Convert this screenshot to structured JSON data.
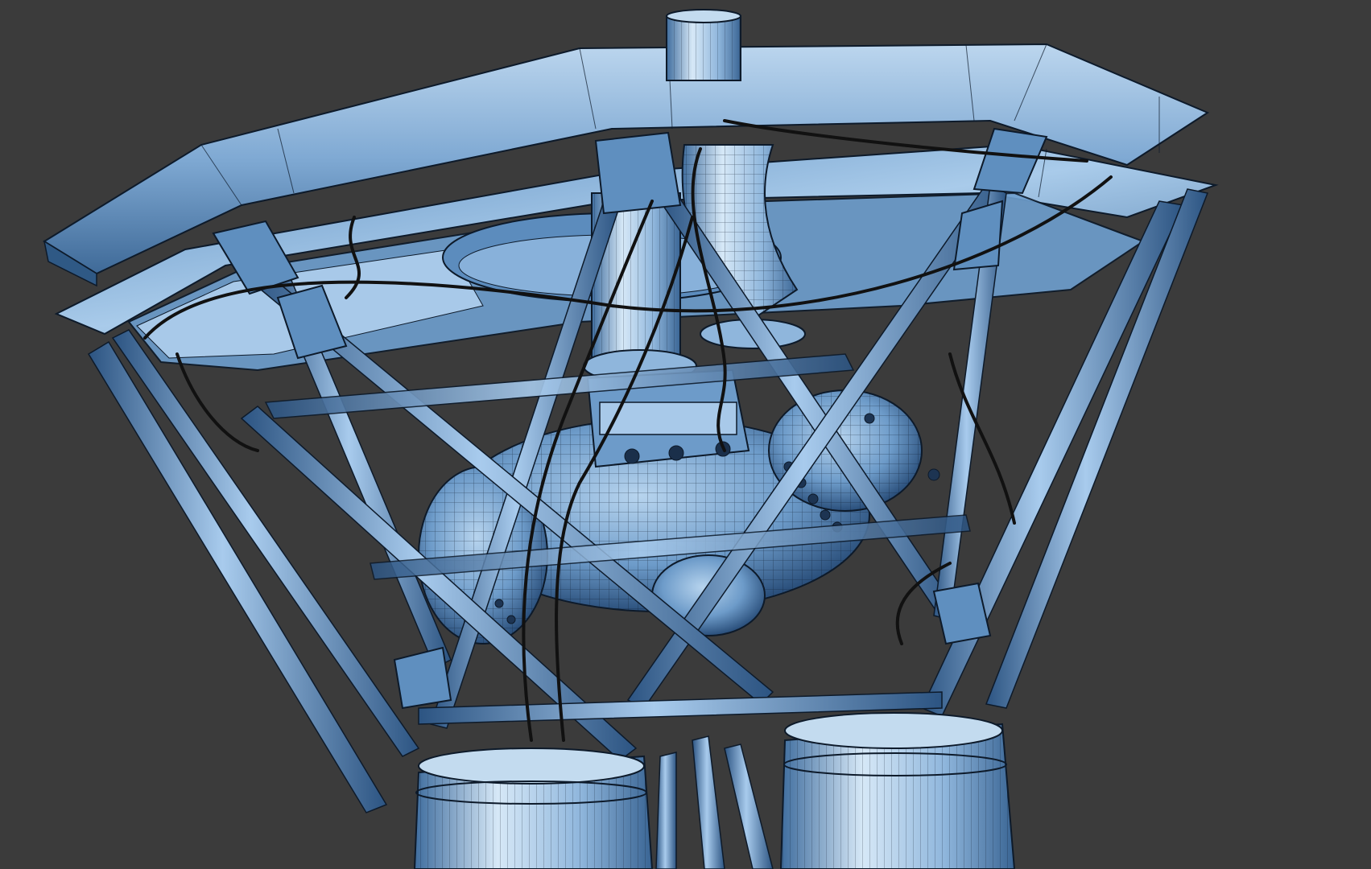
{
  "viewport": {
    "background_color": "#3b3b3b",
    "render_style": "wireframe-shaded",
    "model": {
      "primary_color": "#6f9fcf",
      "highlight_color": "#c8e0f4",
      "shadow_color": "#1f3a5c",
      "wire_color": "#0d1a2a",
      "cable_color": "#111111"
    }
  }
}
